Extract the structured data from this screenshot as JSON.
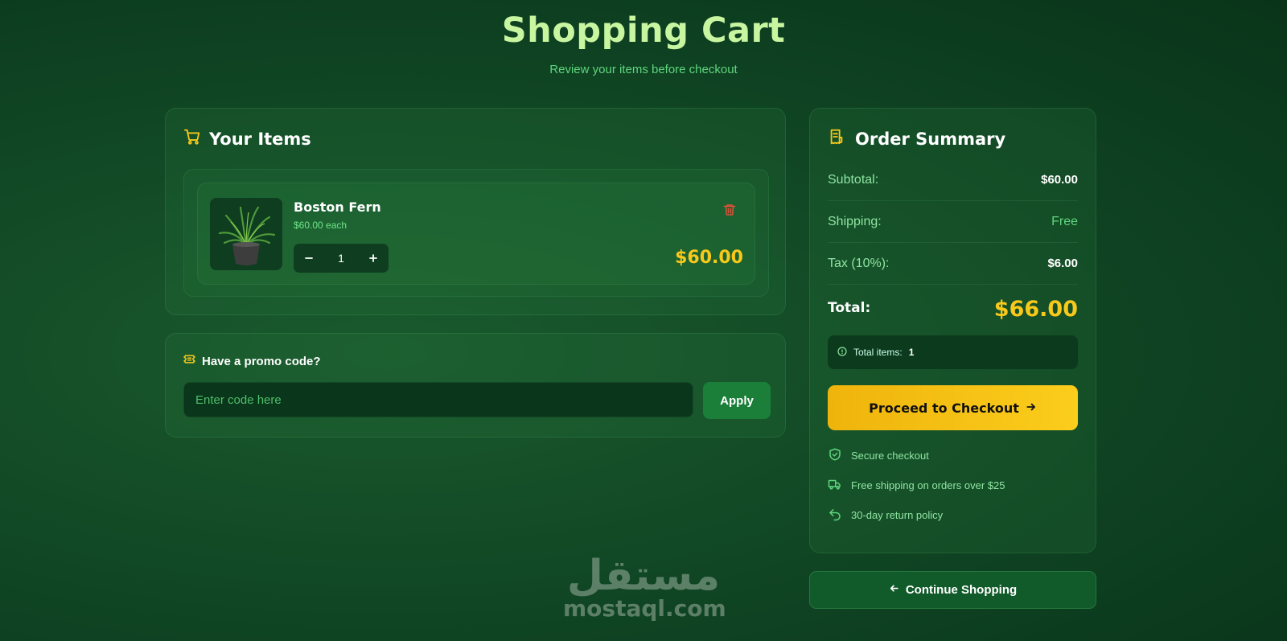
{
  "header": {
    "title": "Shopping Cart",
    "subtitle": "Review your items before checkout"
  },
  "items_section": {
    "title": "Your Items",
    "icon": "cart-icon",
    "items": [
      {
        "name": "Boston Fern",
        "unit_price": "$60.00 each",
        "quantity": "1",
        "line_total": "$60.00",
        "image": "plant-thumbnail"
      }
    ]
  },
  "promo": {
    "label": "Have a promo code?",
    "placeholder": "Enter code here",
    "apply_label": "Apply"
  },
  "summary": {
    "title": "Order Summary",
    "rows": [
      {
        "label": "Subtotal:",
        "value": "$60.00"
      },
      {
        "label": "Shipping:",
        "value": "Free"
      },
      {
        "label": "Tax (10%):",
        "value": "$6.00"
      }
    ],
    "total_label": "Total:",
    "total_value": "$66.00",
    "items_count_label": "Total items:",
    "items_count": "1",
    "checkout_label": "Proceed to Checkout",
    "perks": [
      {
        "icon": "shield-check-icon",
        "text": "Secure checkout"
      },
      {
        "icon": "truck-icon",
        "text": "Free shipping on orders over $25"
      },
      {
        "icon": "return-arrow-icon",
        "text": "30-day return policy"
      }
    ]
  },
  "continue_label": "Continue Shopping",
  "watermark": {
    "arabic": "مستقل",
    "latin": "mostaql.com"
  },
  "colors": {
    "accent_yellow": "#f8c91a",
    "accent_green": "#5fd67e",
    "title_green": "#c7f5a0",
    "trash_red": "#e0523a"
  }
}
